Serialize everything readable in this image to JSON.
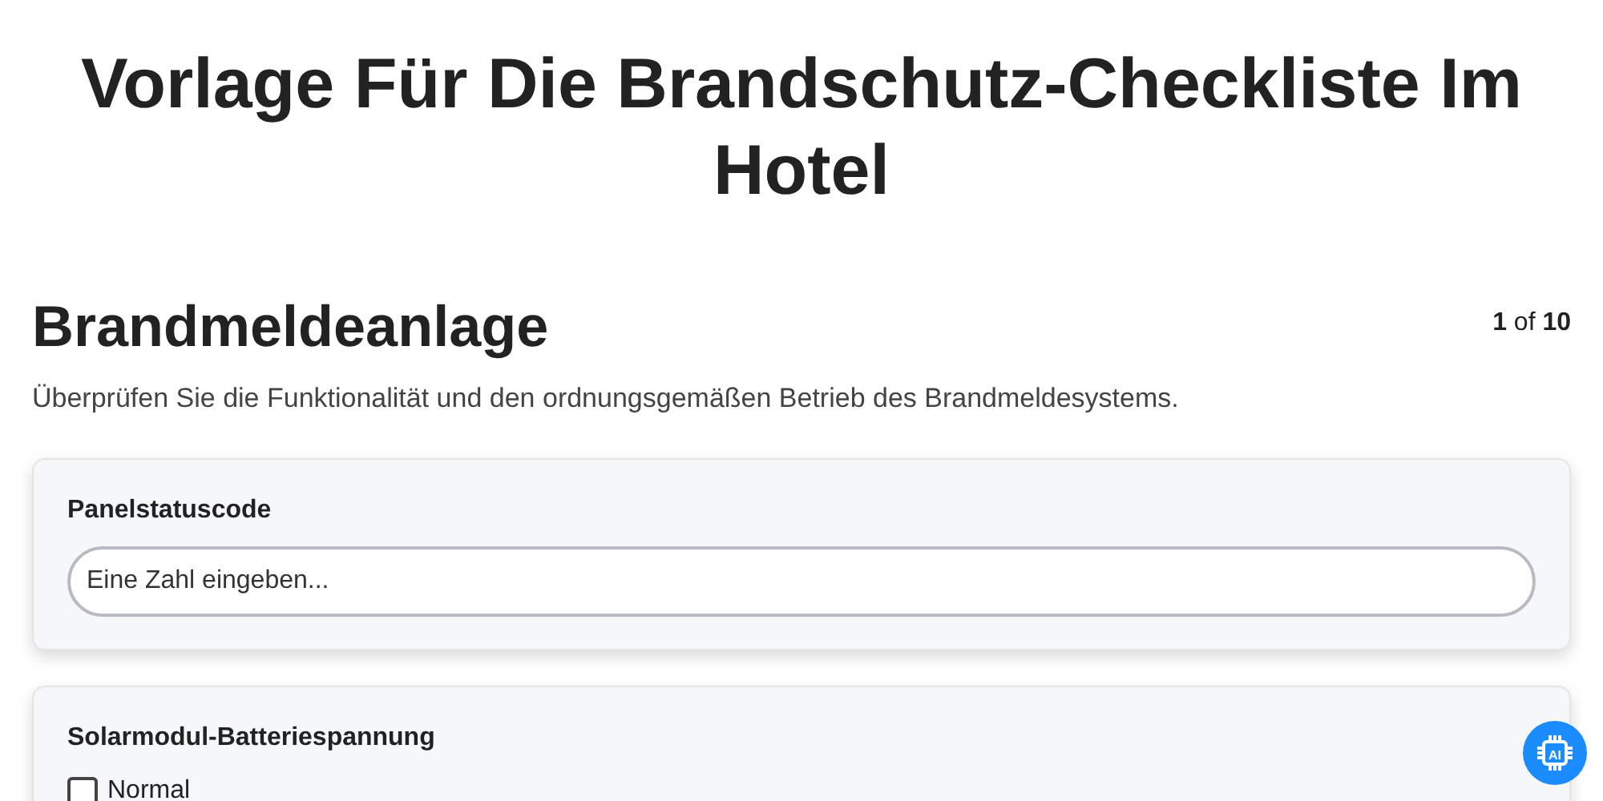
{
  "title": "Vorlage Für Die Brandschutz-Checkliste Im Hotel",
  "section": {
    "heading": "Brandmeldeanlage",
    "pager": "**1** of **10**",
    "description": "Überprüfen Sie die Funktionalität und den ordnungsgemäßen Betrieb des Brandmeldesystems."
  },
  "questions": [
    {
      "kind": "number",
      "label": "Panelstatuscode",
      "placeholder": "Eine Zahl eingeben..."
    },
    {
      "kind": "checkboxes",
      "label": "Solarmodul-Batteriespannung",
      "options": [
        {
          "label": "Normal",
          "checked": false
        }
      ]
    }
  ],
  "assistant_button": {
    "label": "AI"
  }
}
